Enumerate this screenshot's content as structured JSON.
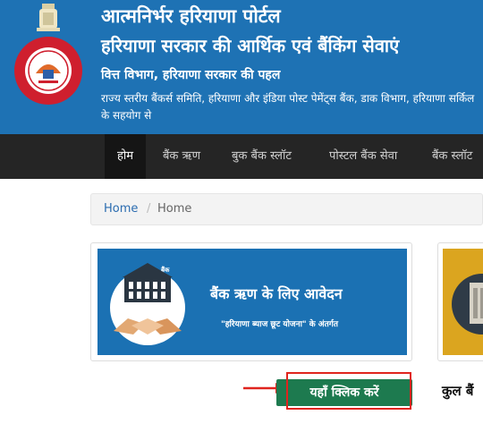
{
  "header": {
    "title_line1": "आत्मनिर्भर हरियाणा पोर्टल",
    "title_line2": "हरियाणा सरकार की आर्थिक एवं बैंकिंग सेवाएं",
    "subtitle": "वित्त विभाग, हरियाणा सरकार की पहल",
    "description": "राज्य स्तरीय बैंकर्स समिति, हरियाणा और इंडिया पोस्ट पेमेंट्स बैंक, डाक विभाग, हरियाणा सर्किल के सहयोग से"
  },
  "emblem": {
    "icon": "haryana-emblem-icon",
    "text": "GOVT. OF HARYANA"
  },
  "nav": {
    "items": [
      {
        "label": "होम",
        "active": true
      },
      {
        "label": "बैंक ऋण",
        "active": false
      },
      {
        "label": "बुक बैंक स्लॉट",
        "active": false
      },
      {
        "label": "पोस्टल बैंक सेवा",
        "active": false
      },
      {
        "label": "बैंक स्लॉट",
        "active": false
      }
    ]
  },
  "breadcrumb": {
    "link": "Home",
    "separator": "/",
    "current": "Home"
  },
  "card1": {
    "title": "बैंक ऋण के लिए आवेदन",
    "subtitle": "\"हरियाणा ब्याज छूट योजना\" के अंतर्गत",
    "bank_label": "बैंक"
  },
  "click_button": {
    "label": "यहाँ क्लिक करें"
  },
  "total_text": "कुल बैं",
  "colors": {
    "header_bg": "#1e72b4",
    "nav_bg": "#252525",
    "button_green": "#1d7a4f",
    "highlight_red": "#e0241e",
    "card1_bg": "#1b71b3",
    "card2_bg": "#dba51f"
  }
}
